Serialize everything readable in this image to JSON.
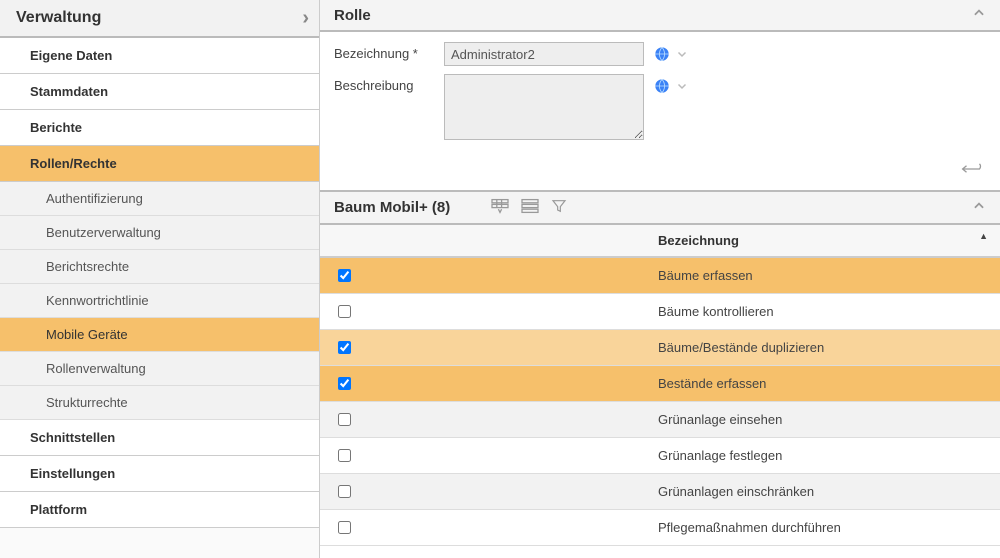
{
  "sidebar": {
    "title": "Verwaltung",
    "items": [
      {
        "label": "Eigene Daten",
        "indent": 0,
        "selected": false
      },
      {
        "label": "Stammdaten",
        "indent": 0,
        "selected": false
      },
      {
        "label": "Berichte",
        "indent": 0,
        "selected": false
      },
      {
        "label": "Rollen/Rechte",
        "indent": 0,
        "selected": true
      },
      {
        "label": "Authentifizierung",
        "indent": 1,
        "selected": false
      },
      {
        "label": "Benutzerverwaltung",
        "indent": 1,
        "selected": false
      },
      {
        "label": "Berichtsrechte",
        "indent": 1,
        "selected": false
      },
      {
        "label": "Kennwortrichtlinie",
        "indent": 1,
        "selected": false
      },
      {
        "label": "Mobile Geräte",
        "indent": 1,
        "selected": true
      },
      {
        "label": "Rollenverwaltung",
        "indent": 1,
        "selected": false
      },
      {
        "label": "Strukturrechte",
        "indent": 1,
        "selected": false
      },
      {
        "label": "Schnittstellen",
        "indent": 0,
        "selected": false
      },
      {
        "label": "Einstellungen",
        "indent": 0,
        "selected": false
      },
      {
        "label": "Plattform",
        "indent": 0,
        "selected": false
      }
    ]
  },
  "rolePanel": {
    "title": "Rolle",
    "fields": {
      "name_label": "Bezeichnung *",
      "name_value": "Administrator2",
      "desc_label": "Beschreibung",
      "desc_value": ""
    }
  },
  "permissionsPanel": {
    "title": "Baum Mobil+ (8)",
    "column_header": "Bezeichnung",
    "rows": [
      {
        "checked": true,
        "label": "Bäume erfassen"
      },
      {
        "checked": false,
        "label": "Bäume kontrollieren"
      },
      {
        "checked": true,
        "label": "Bäume/Bestände duplizieren"
      },
      {
        "checked": true,
        "label": "Bestände erfassen"
      },
      {
        "checked": false,
        "label": "Grünanlage einsehen"
      },
      {
        "checked": false,
        "label": "Grünanlage festlegen"
      },
      {
        "checked": false,
        "label": "Grünanlagen einschränken"
      },
      {
        "checked": false,
        "label": "Pflegemaßnahmen durchführen"
      }
    ]
  }
}
